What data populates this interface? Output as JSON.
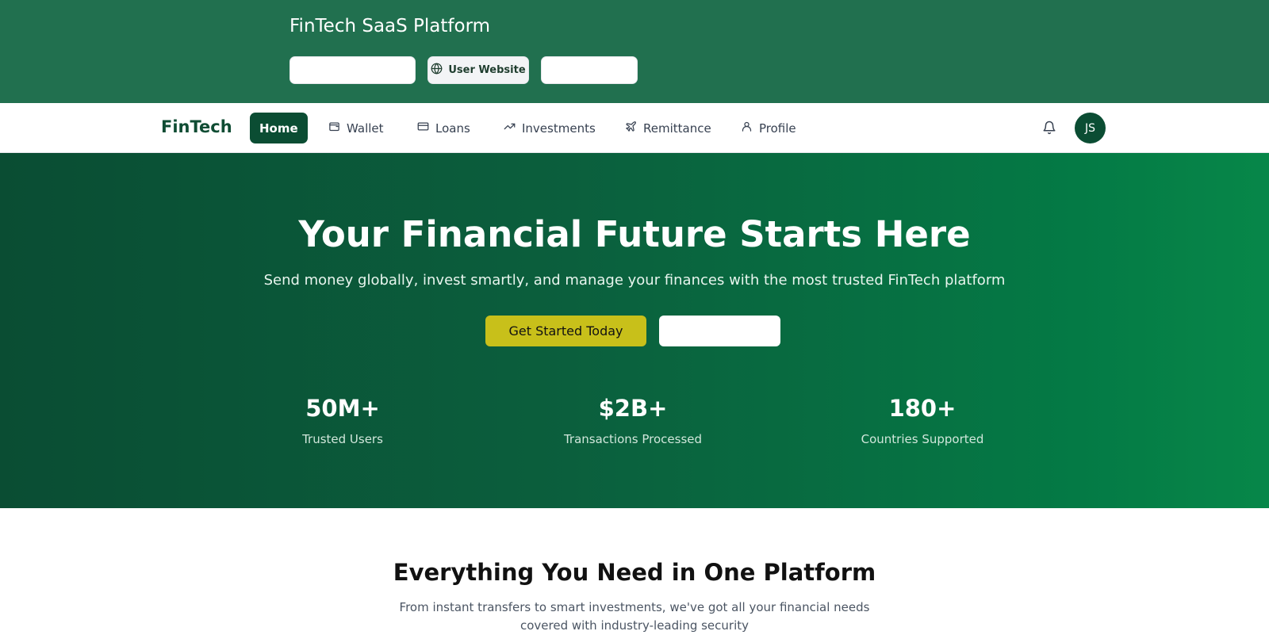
{
  "banner": {
    "title": "FinTech SaaS Platform",
    "buttons": [
      {
        "label": ""
      },
      {
        "label": "User Website",
        "icon": "globe-icon"
      },
      {
        "label": ""
      }
    ]
  },
  "nav": {
    "logo": "FinTech",
    "items": [
      {
        "label": "Home",
        "icon": "",
        "active": true
      },
      {
        "label": "Wallet",
        "icon": "wallet-icon"
      },
      {
        "label": "Loans",
        "icon": "credit-card-icon"
      },
      {
        "label": "Investments",
        "icon": "trending-up-icon"
      },
      {
        "label": "Remittance",
        "icon": "plane-icon"
      },
      {
        "label": "Profile",
        "icon": "user-icon"
      }
    ],
    "avatar_initials": "JS",
    "notification_icon": "bell-icon"
  },
  "hero": {
    "title": "Your Financial Future Starts Here",
    "subtitle": "Send money globally, invest smartly, and manage your finances with the most trusted FinTech platform",
    "primary_cta": "Get Started Today",
    "secondary_cta": "",
    "stats": [
      {
        "value": "50M+",
        "label": "Trusted Users"
      },
      {
        "value": "$2B+",
        "label": "Transactions Processed"
      },
      {
        "value": "180+",
        "label": "Countries Supported"
      }
    ]
  },
  "features": {
    "title": "Everything You Need in One Platform",
    "subtitle": "From instant transfers to smart investments, we've got all your financial needs covered with industry-leading security"
  },
  "colors": {
    "brand_dark_green": "#0b4d33",
    "accent_yellow": "#c8c01a",
    "banner_green": "#21704f"
  }
}
